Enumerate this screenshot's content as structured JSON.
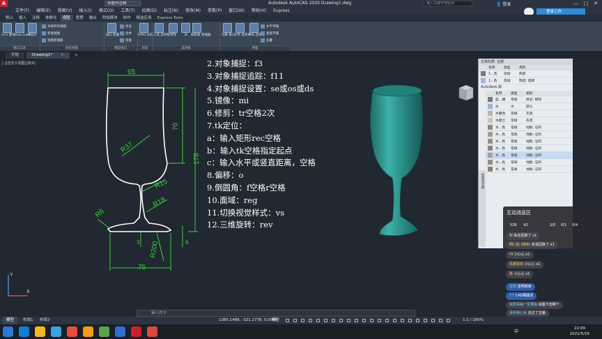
{
  "app": {
    "window_title": "Autodesk AutoCAD 2020    Drawing1.dwg",
    "workspace": "草图与注释",
    "search_placeholder": "输入关键字或短语",
    "login": "登录",
    "minimize": "—",
    "maximize": "□",
    "close": "✕",
    "signin_button": "登录工作"
  },
  "menu": [
    "文件(F)",
    "编辑(E)",
    "视图(V)",
    "插入(I)",
    "格式(O)",
    "工具(T)",
    "绘图(D)",
    "标注(N)",
    "修改(M)",
    "参数(P)",
    "窗口(W)",
    "帮助(H)",
    "Express"
  ],
  "ribbon_tabs": [
    "默认",
    "插入",
    "注释",
    "参数化",
    "视图",
    "管理",
    "输出",
    "附加模块",
    "协作",
    "精选应用",
    "Express Tools"
  ],
  "ribbon_active_tab": 4,
  "ribbon": {
    "buttons": [
      {
        "label": "UCS\n图标",
        "name": "ucs-icon-button"
      },
      {
        "label": "View\nCube",
        "name": "viewcube-button"
      },
      {
        "label": "导航栏",
        "name": "nav-bar-button"
      },
      {
        "label": "视口\n配置",
        "name": "viewport-config-button"
      },
      {
        "label": "DWG\n比较",
        "name": "dwg-compare-button"
      },
      {
        "label": "工具\n选项板",
        "name": "tool-palettes-button"
      },
      {
        "label": "特性",
        "name": "properties-button"
      },
      {
        "label": "块",
        "name": "block-button"
      },
      {
        "label": "图纸集\n管理器",
        "name": "sheetset-button"
      },
      {
        "label": "切换\n窗口",
        "name": "switch-windows-button"
      },
      {
        "label": "文件\n选项卡",
        "name": "file-tabs-button"
      },
      {
        "label": "布局\n选项卡",
        "name": "layout-tabs-button"
      }
    ],
    "small": [
      {
        "label": "未保存的视图",
        "name": "unsaved-view-dropdown"
      },
      {
        "label": "新建视图",
        "name": "new-view-button"
      },
      {
        "label": "视图管理器",
        "name": "view-manager-button"
      },
      {
        "label": "命名",
        "name": "named-viewports-button"
      },
      {
        "label": "合并",
        "name": "join-viewports-button"
      },
      {
        "label": "恢复",
        "name": "restore-viewports-button"
      },
      {
        "label": "水平平铺",
        "name": "tile-horizontal-button"
      },
      {
        "label": "垂直平铺",
        "name": "tile-vertical-button"
      },
      {
        "label": "层叠",
        "name": "cascade-button"
      }
    ],
    "groups": [
      "视口工具",
      "命名视图",
      "模型视口",
      "比较",
      "选项板",
      "界面"
    ]
  },
  "file_tabs": [
    {
      "label": "开始",
      "active": false
    },
    {
      "label": "Drawing1*",
      "active": true
    }
  ],
  "viewport_label": "[-][自定义视图][真实]",
  "drawing": {
    "dims": {
      "top_width": "65",
      "bowl_height": "70",
      "total_height": "178",
      "bowl_radius": "R37",
      "fillet1": "R15",
      "fillet2": "R18",
      "base_radius": "R6",
      "base_width": "75",
      "base_arc": "R200",
      "small1": "3",
      "small2": "6"
    },
    "ucs_x": "X",
    "ucs_y": "Y"
  },
  "steps": [
    "2.对象捕捉：f3",
    "3.对象捕捉追踪：f11",
    "4.对象捕捉设置：se或os或ds",
    "5.镜像：mi",
    "6.修剪：tr空格2次",
    "7.tk定位：",
    "a：输入矩形rec空格",
    "b：输入tk空格指定起点",
    "c：输入水平或竖直距离，空格",
    "8.偏移：o",
    "9.倒圆角：f空格r空格",
    "10.面域：reg",
    "11.切换视觉样式：vs",
    "12.三维旋转：rev"
  ],
  "palette": {
    "header": [
      "文档材质: 全部"
    ],
    "columns": [
      "名称",
      "类型",
      "类别"
    ],
    "doc_rows": [
      {
        "name": "1...克",
        "type": "常规",
        "cat": "陶瓷"
      },
      {
        "name": "1...色",
        "type": "常规",
        "cat": "陶瓷: 瓷砖"
      }
    ],
    "library_path": "Autodesk 库",
    "library_tab": "主视图",
    "lib_rows": [
      {
        "name": "蓝...槽",
        "type": "常规",
        "cat": "拼石: 砌块"
      },
      {
        "name": "水",
        "type": "水",
        "cat": "默认"
      },
      {
        "name": "水磨色",
        "type": "常规",
        "cat": "灰泥"
      },
      {
        "name": "水磨土",
        "type": "常规",
        "cat": "灰泥"
      },
      {
        "name": "水...色",
        "type": "常规",
        "cat": "地板: 石料"
      },
      {
        "name": "水...色",
        "type": "常规",
        "cat": "地板: 石料"
      },
      {
        "name": "水...色",
        "type": "常规",
        "cat": "地板: 石料"
      },
      {
        "name": "水...色",
        "type": "常规",
        "cat": "地板: 石料"
      },
      {
        "name": "水...色",
        "type": "常规",
        "cat": "地板: 石料"
      },
      {
        "name": "水...色",
        "type": "常规",
        "cat": "地板: 石料"
      },
      {
        "name": "水...色",
        "type": "常规",
        "cat": "地板: 石料"
      }
    ],
    "side_tab": "材质浏览器"
  },
  "chat": {
    "title": "互动消息区",
    "stats": [
      "526",
      "42"
    ],
    "counts": [
      "2/0",
      "0/1",
      "0/4"
    ],
    "messages": [
      {
        "user": "梨",
        "text": "私信回复了 x1"
      },
      {
        "user": "明川亚 (特效)",
        "text": "私信回复了 x1"
      },
      {
        "user": "HI",
        "text": "小心心 x1"
      },
      {
        "user": "优越喜欢",
        "text": "小心心 x1"
      },
      {
        "user": "陈",
        "text": "小心心 x1"
      },
      {
        "user": "古阳",
        "text": "送明玻璃"
      },
      {
        "user": "T.T",
        "text": "CAD哪版本"
      },
      {
        "user": "缺爱得病一生降临",
        "text": "绘图下选哪个"
      },
      {
        "user": "请手我心女",
        "text": "关注了主播"
      }
    ]
  },
  "command_placeholder": "键入命令",
  "status": {
    "tabs": [
      "模型",
      "布局1",
      "布局2"
    ],
    "coords": "1385.1486, -321.2778, 0.0000",
    "mode": "模型",
    "scale": "1:1 / 100%"
  },
  "taskbar": {
    "lang": "中",
    "time": "22:09",
    "date": "2021/5/16"
  },
  "colors": {
    "canvas": "#212831",
    "ribbon": "#3a4654",
    "dim_green": "#3cd23c",
    "glass_teal": "#2e9b93",
    "chat_blue": "#3662b0"
  }
}
